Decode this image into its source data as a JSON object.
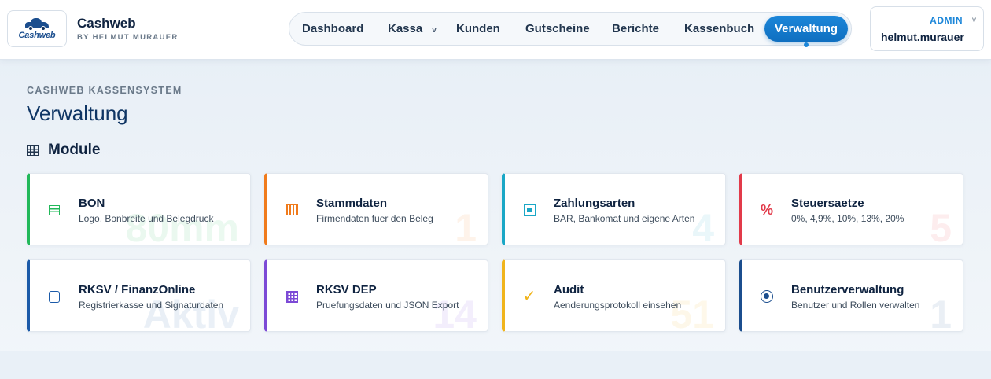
{
  "header": {
    "logo_text": "Cashweb",
    "brand_title": "Cashweb",
    "brand_subtitle": "BY HELMUT MURAUER",
    "nav": [
      {
        "label": "Dashboard"
      },
      {
        "label": "Kassa",
        "caret": "v"
      },
      {
        "label": "Kunden"
      },
      {
        "label": "Gutscheine"
      },
      {
        "label": "Berichte"
      },
      {
        "label": "Kassenbuch"
      },
      {
        "label": "Verwaltung",
        "active": true
      }
    ],
    "user": {
      "role": "ADMIN",
      "caret": "v",
      "name": "helmut.murauer"
    }
  },
  "main": {
    "kicker": "CASHWEB KASSENSYSTEM",
    "title": "Verwaltung",
    "section_icon": "grid-icon",
    "section_title": "Module",
    "cards": [
      {
        "title": "BON",
        "desc": "Logo, Bonbreite und Belegdruck",
        "bg": "80mm",
        "icon": "receipt-icon",
        "color": "#22b85a"
      },
      {
        "title": "Stammdaten",
        "desc": "Firmendaten fuer den Beleg",
        "bg": "1",
        "icon": "barcode-icon",
        "color": "#f07b1c"
      },
      {
        "title": "Zahlungsarten",
        "desc": "BAR, Bankomat und eigene Arten",
        "bg": "4",
        "icon": "payment-icon",
        "color": "#1aa7c6"
      },
      {
        "title": "Steuersaetze",
        "desc": "0%, 4,9%, 10%, 13%, 20%",
        "bg": "5",
        "icon": "percent-icon",
        "icon_glyph": "%",
        "color": "#e23a4a"
      },
      {
        "title": "RKSV / FinanzOnline",
        "desc": "Registrierkasse und Signaturdaten",
        "bg": "Aktiv",
        "icon": "register-icon",
        "color": "#1b5aa8"
      },
      {
        "title": "RKSV DEP",
        "desc": "Pruefungsdaten und JSON Export",
        "bg": "14",
        "icon": "export-grid-icon",
        "color": "#7c4ad6"
      },
      {
        "title": "Audit",
        "desc": "Aenderungsprotokoll einsehen",
        "bg": "51",
        "icon": "check-icon",
        "icon_glyph": "✓",
        "color": "#f0b41c"
      },
      {
        "title": "Benutzerverwaltung",
        "desc": "Benutzer und Rollen verwalten",
        "bg": "1",
        "icon": "user-icon",
        "color": "#1b4e8e"
      }
    ]
  }
}
